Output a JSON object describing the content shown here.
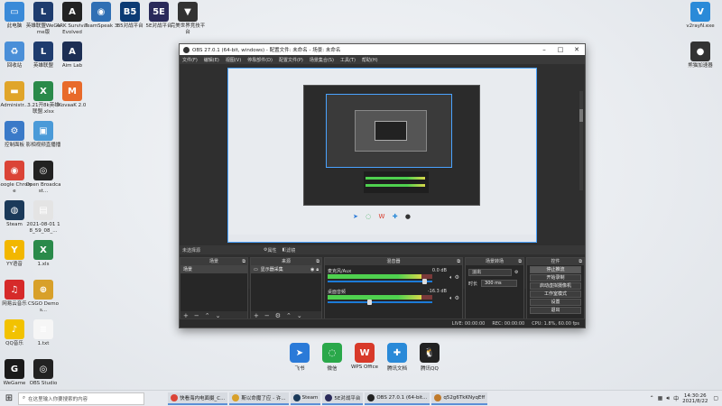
{
  "desktop": {
    "icons_left": [
      {
        "label": "此电脑",
        "color": "#3a8ad8",
        "glyph": "▭"
      },
      {
        "label": "英雄联盟WeGame版",
        "color": "#1e3c6e",
        "glyph": "L"
      },
      {
        "label": "ARK Survival Evolved",
        "color": "#222222",
        "glyph": "A"
      },
      {
        "label": "TeamSpeak 3",
        "color": "#2f6fb4",
        "glyph": "◉"
      },
      {
        "label": "B5对战平台",
        "color": "#0c3b74",
        "glyph": "B5"
      },
      {
        "label": "5E对战平台",
        "color": "#2a2a5a",
        "glyph": "5E"
      },
      {
        "label": "完美世界竞技平台",
        "color": "#333333",
        "glyph": "▼"
      },
      {
        "label": "回收站",
        "color": "#4a8fd8",
        "glyph": "♻"
      },
      {
        "label": "英雄联盟",
        "color": "#1e3c6e",
        "glyph": "L"
      },
      {
        "label": "Aim Lab",
        "color": "#1d2f54",
        "glyph": "A"
      },
      {
        "label": "Administr...",
        "color": "#e0a52a",
        "glyph": "▬"
      },
      {
        "label": "3.21开8k英雄联盟.xlsx",
        "color": "#2a8a4a",
        "glyph": "X"
      },
      {
        "label": "KovaaK 2.0",
        "color": "#e86a2a",
        "glyph": "M"
      },
      {
        "label": "控制面板",
        "color": "#3a7ac8",
        "glyph": "⚙"
      },
      {
        "label": "影相视频直播播",
        "color": "#4a9ad8",
        "glyph": "▣"
      },
      {
        "label": "Google Chrome",
        "color": "#db4437",
        "glyph": "◉"
      },
      {
        "label": "Open Broadcast...",
        "color": "#222222",
        "glyph": "◎"
      },
      {
        "label": "Steam",
        "color": "#1b3a5a",
        "glyph": "◍"
      },
      {
        "label": "2021-08-01 18_59_08_...",
        "color": "#e4e4e4",
        "glyph": "▤"
      },
      {
        "label": "YY语音",
        "color": "#f2b700",
        "glyph": "Y"
      },
      {
        "label": "1.xls",
        "color": "#2a8a4a",
        "glyph": "X"
      },
      {
        "label": "网易云音乐",
        "color": "#d62a2a",
        "glyph": "♫"
      },
      {
        "label": "CSGO Demos...",
        "color": "#d8a02a",
        "glyph": "⊕"
      },
      {
        "label": "QQ音乐",
        "color": "#f2c200",
        "glyph": "♪"
      },
      {
        "label": "1.txt",
        "color": "#f6f6f6",
        "glyph": "≡"
      },
      {
        "label": "WeGame",
        "color": "#1a1a1a",
        "glyph": "G"
      },
      {
        "label": "OBS Studio",
        "color": "#222222",
        "glyph": "◎"
      }
    ],
    "icons_right": [
      {
        "label": "v2rayN.exe",
        "color": "#2a8ad8",
        "glyph": "V"
      },
      {
        "label": "熊猫加速器",
        "color": "#333333",
        "glyph": "●"
      }
    ]
  },
  "obs": {
    "title": "OBS 27.0.1 (64-bit, windows) - 配置文件: 未命名 - 场景: 未命名",
    "menu": [
      "文件(F)",
      "编辑(E)",
      "视图(V)",
      "停靠部件(D)",
      "配置文件(P)",
      "场景集合(S)",
      "工具(T)",
      "帮助(H)"
    ],
    "toolbar": {
      "source_label": "未选择源",
      "properties": "属性",
      "filters": "滤镜"
    },
    "scenes": {
      "header": "场景",
      "items": [
        "场景"
      ]
    },
    "sources": {
      "header": "来源",
      "items": [
        "显示器采集"
      ]
    },
    "mixer": {
      "header": "混音器",
      "tracks": [
        {
          "name": "麦克风/Aux",
          "db": "0.0 dB",
          "level": 0.9,
          "volume": 0.92
        },
        {
          "name": "桌面音频",
          "db": "-16.3 dB",
          "level": 0.9,
          "volume": 0.4
        }
      ]
    },
    "transitions": {
      "header": "场景转场",
      "type": "淡出",
      "duration_label": "时长",
      "duration": "300 ms"
    },
    "controls": {
      "header": "控件",
      "buttons": [
        "停止推流",
        "开始录制",
        "启动虚拟摄像机",
        "工作室模式",
        "设置",
        "退出"
      ]
    },
    "status": [
      "LIVE: 00:00:00",
      "REC: 00:00:00",
      "CPU: 1.8%, 60.00 fps"
    ],
    "nested_dock": [
      "飞书",
      "微信",
      "WPS Office",
      "腾讯文档",
      "腾讯QQ"
    ]
  },
  "dock_apps": [
    {
      "label": "飞书",
      "color": "#2a7ad8",
      "glyph": "➤"
    },
    {
      "label": "微信",
      "color": "#2aa84a",
      "glyph": "◌"
    },
    {
      "label": "WPS Office",
      "color": "#d83a2a",
      "glyph": "W"
    },
    {
      "label": "腾讯文档",
      "color": "#2a8ad8",
      "glyph": "✚"
    },
    {
      "label": "腾讯QQ",
      "color": "#222222",
      "glyph": "🐧"
    }
  ],
  "taskbar": {
    "search_placeholder": "在这里输入你要搜索的内容",
    "apps": [
      {
        "label": "快看海内电面摄_C...",
        "color": "#db4437"
      },
      {
        "label": "斯以命魔了应 - 许...",
        "color": "#d8a02a"
      },
      {
        "label": "Steam",
        "color": "#1b3a5a"
      },
      {
        "label": "5E对战平台",
        "color": "#2a2a5a"
      },
      {
        "label": "OBS 27.0.1 (64-bit...",
        "color": "#222222"
      },
      {
        "label": "q52g6TkKNyqEff",
        "color": "#c07a2a"
      }
    ],
    "time": "14:30:26",
    "date": "2021/8/22"
  }
}
